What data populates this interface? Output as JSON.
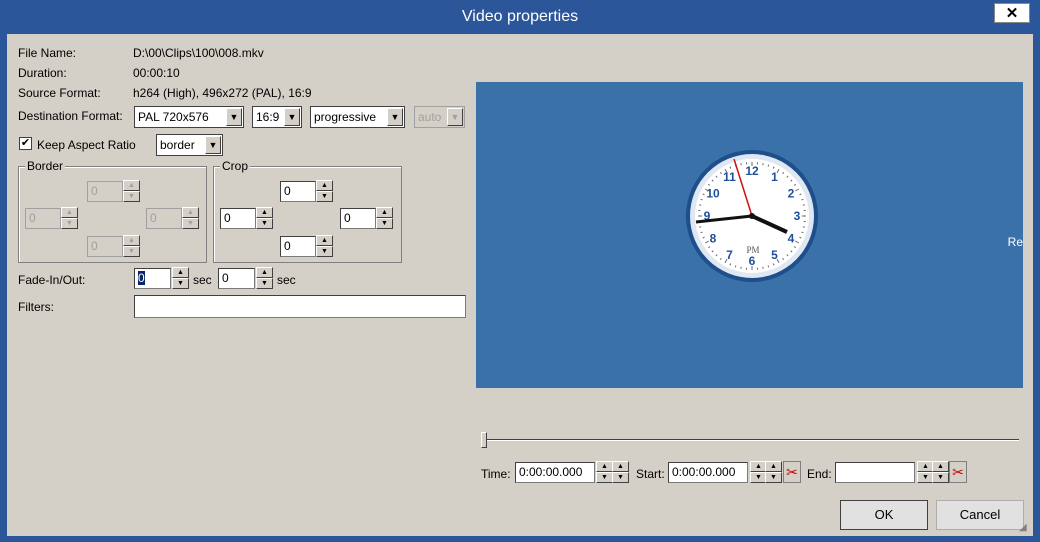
{
  "window": {
    "title": "Video properties",
    "close_glyph": "✕"
  },
  "info": {
    "file_name_label": "File Name:",
    "file_name": "D:\\00\\Clips\\100\\008.mkv",
    "duration_label": "Duration:",
    "duration": "00:00:10",
    "source_format_label": "Source Format:",
    "source_format": "h264 (High), 496x272 (PAL), 16:9"
  },
  "destination": {
    "label": "Destination Format:",
    "format": "PAL 720x576",
    "aspect": "16:9",
    "scan": "progressive",
    "auto": "auto"
  },
  "keep_aspect": {
    "label": "Keep Aspect Ratio",
    "checked": true,
    "mode": "border"
  },
  "border": {
    "title": "Border",
    "top": "0",
    "left": "0",
    "right": "0",
    "bottom": "0"
  },
  "crop": {
    "title": "Crop",
    "top": "0",
    "left": "0",
    "right": "0",
    "bottom": "0"
  },
  "fade": {
    "label": "Fade-In/Out:",
    "in": "0",
    "in_unit": "sec",
    "out": "0",
    "out_unit": "sec"
  },
  "filters": {
    "label": "Filters:",
    "value": ""
  },
  "preview": {
    "edge_text": "Re",
    "clock_period": "PM",
    "clock_numbers": [
      "12",
      "1",
      "2",
      "3",
      "4",
      "5",
      "6",
      "7",
      "8",
      "9",
      "10",
      "11"
    ]
  },
  "timeline": {
    "time_label": "Time:",
    "time_value": "0:00:00.000",
    "start_label": "Start:",
    "start_value": "0:00:00.000",
    "end_label": "End:",
    "end_value": ""
  },
  "buttons": {
    "ok": "OK",
    "cancel": "Cancel"
  },
  "icons": {
    "spin_up": "▲",
    "spin_down": "▼",
    "dropdown": "▼",
    "check": "✔",
    "scissors": "✂",
    "grip": "◢"
  }
}
